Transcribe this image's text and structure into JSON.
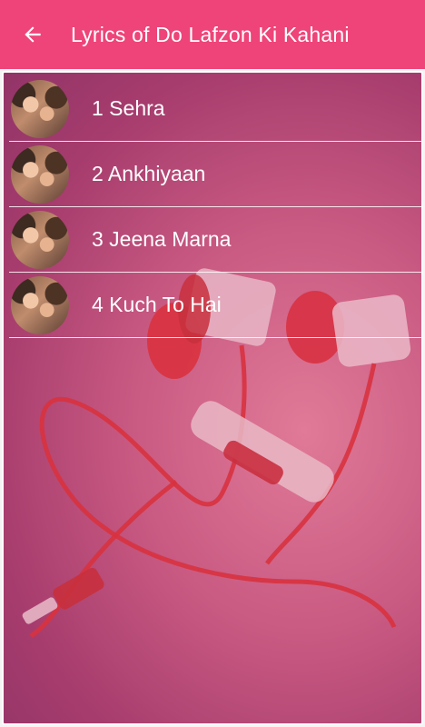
{
  "appbar": {
    "title": "Lyrics of Do Lafzon Ki Kahani",
    "back_icon": "arrow-left-icon"
  },
  "songs": [
    {
      "label": "1 Sehra"
    },
    {
      "label": "2 Ankhiyaan"
    },
    {
      "label": "3 Jeena Marna"
    },
    {
      "label": "4 Kuch To Hai"
    }
  ],
  "theme": {
    "accent": "#ee4479",
    "text": "#ffffff"
  }
}
